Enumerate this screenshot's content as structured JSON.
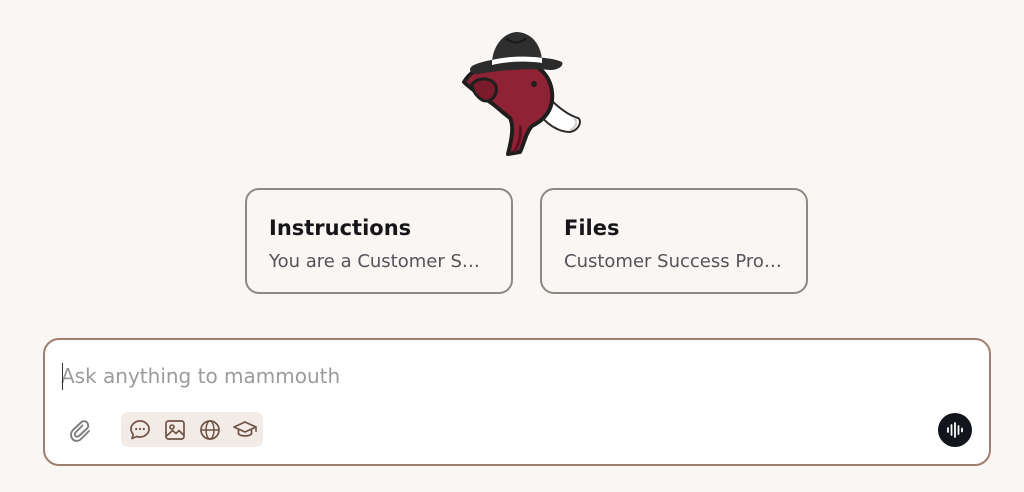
{
  "cards": [
    {
      "title": "Instructions",
      "subtitle": "You are a Customer Success Professional"
    },
    {
      "title": "Files",
      "subtitle": "Customer Success Professional"
    }
  ],
  "composer": {
    "placeholder": "Ask anything to mammouth"
  },
  "icons": {
    "logo": "mammoth-fedora-logo",
    "attach": "paperclip-icon",
    "tools": [
      "chat-bubble-icon",
      "image-icon",
      "globe-icon",
      "graduation-cap-icon"
    ],
    "voice": "sound-wave-icon"
  },
  "colors": {
    "background": "#faf6f3",
    "mammoth": "#8f2235",
    "hat": "#2b2b2b",
    "card_border": "#8f8983",
    "composer_border": "#a17f70",
    "tool_icon": "#6f5346",
    "voice_button": "#13151c"
  }
}
